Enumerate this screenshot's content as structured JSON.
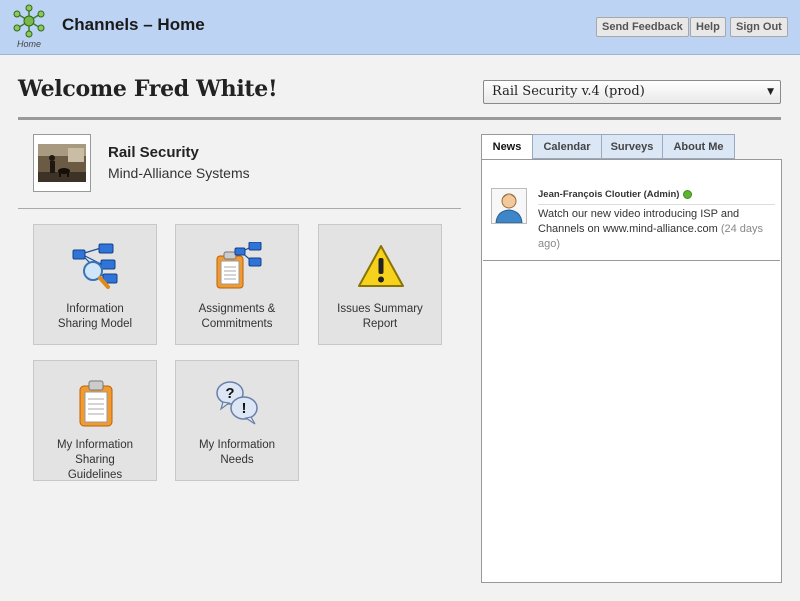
{
  "header": {
    "logo_caption": "Home",
    "title": "Channels – Home",
    "buttons": {
      "feedback": "Send Feedback",
      "help": "Help",
      "signout": "Sign Out"
    }
  },
  "welcome": "Welcome Fred White!",
  "plan_selector": {
    "selected": "Rail Security v.4 (prod)"
  },
  "plan": {
    "name": "Rail Security",
    "org": "Mind-Alliance Systems"
  },
  "tiles": {
    "t1": {
      "line1": "Information",
      "line2": "Sharing Model"
    },
    "t2": {
      "line1": "Assignments &",
      "line2": "Commitments"
    },
    "t3": {
      "line1": "Issues Summary",
      "line2": "Report"
    },
    "t4": {
      "line1": "My Information",
      "line2": "Sharing",
      "line3": "Guidelines"
    },
    "t5": {
      "line1": "My Information",
      "line2": "Needs"
    }
  },
  "tabs": [
    "News",
    "Calendar",
    "Surveys",
    "About Me"
  ],
  "news": [
    {
      "author": "Jean-François Cloutier (Admin)",
      "message": "Watch our new video introducing ISP and Channels on www.mind-alliance.com",
      "age": "(24 days ago)"
    }
  ],
  "colors": {
    "header_bg": "#bcd3f3",
    "online": "#5cb531",
    "tab_bg": "#dce7f6"
  }
}
